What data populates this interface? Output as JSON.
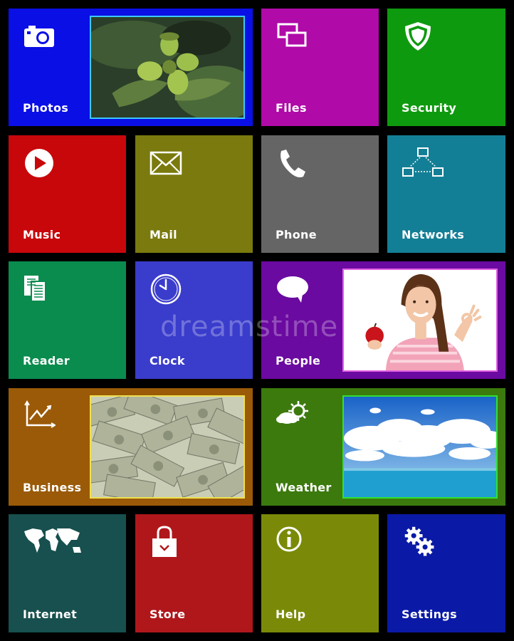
{
  "tiles": {
    "photos": {
      "label": "Photos",
      "color": "#0a0fe6"
    },
    "files": {
      "label": "Files",
      "color": "#b00aa8"
    },
    "security": {
      "label": "Security",
      "color": "#0e9a0e"
    },
    "music": {
      "label": "Music",
      "color": "#c8070a"
    },
    "mail": {
      "label": "Mail",
      "color": "#7a7a0e"
    },
    "phone": {
      "label": "Phone",
      "color": "#656565"
    },
    "networks": {
      "label": "Networks",
      "color": "#137f96"
    },
    "reader": {
      "label": "Reader",
      "color": "#0a8c4e"
    },
    "clock": {
      "label": "Clock",
      "color": "#3a3ccc"
    },
    "people": {
      "label": "People",
      "color": "#6a0aa0"
    },
    "business": {
      "label": "Business",
      "color": "#9a5a08"
    },
    "weather": {
      "label": "Weather",
      "color": "#3c7a0e"
    },
    "internet": {
      "label": "Internet",
      "color": "#17504e"
    },
    "store": {
      "label": "Store",
      "color": "#b0171b"
    },
    "help": {
      "label": "Help",
      "color": "#7a8a08"
    },
    "settings": {
      "label": "Settings",
      "color": "#0a1aa6"
    }
  },
  "icons": {
    "photos": "camera-icon",
    "files": "files-icon",
    "security": "shield-icon",
    "music": "play-icon",
    "mail": "envelope-icon",
    "phone": "phone-icon",
    "networks": "network-icon",
    "reader": "document-icon",
    "clock": "clock-icon",
    "people": "speech-bubble-icon",
    "business": "chart-icon",
    "weather": "sun-cloud-icon",
    "internet": "world-map-icon",
    "store": "shopping-bag-icon",
    "help": "info-icon",
    "settings": "gears-icon"
  },
  "watermark": "dreamstime"
}
